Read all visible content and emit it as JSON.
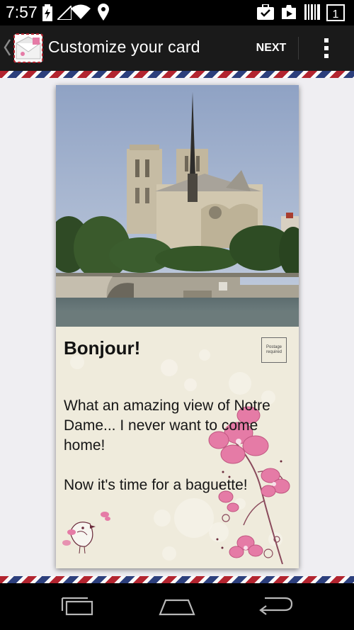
{
  "status_bar": {
    "time": "7:57",
    "left_icons": [
      "battery-charging-icon",
      "signal-icon",
      "wifi-icon",
      "location-icon"
    ],
    "right_icons": [
      "task-check-icon",
      "play-store-icon",
      "barcode-icon",
      "one-icon"
    ],
    "badge_number": "1"
  },
  "action_bar": {
    "title": "Customize your card",
    "next_label": "NEXT",
    "app_icon": "envelope-app-icon",
    "overflow_icon": "overflow-menu-icon"
  },
  "card": {
    "greeting": "Bonjour!",
    "stamp_text": "Postage required",
    "message": "What an amazing view of Notre Dame... I never want to come home!\n\nNow it's time for a baguette!",
    "photo": "notre-dame-photo"
  },
  "nav_bar": {
    "recents_icon": "recents-icon",
    "home_icon": "home-icon",
    "back_icon": "back-icon"
  },
  "colors": {
    "stripe_red": "#b2242f",
    "stripe_blue": "#2c3f7c",
    "card_background": "#efebdc",
    "flower_pink": "#e57ba6"
  }
}
